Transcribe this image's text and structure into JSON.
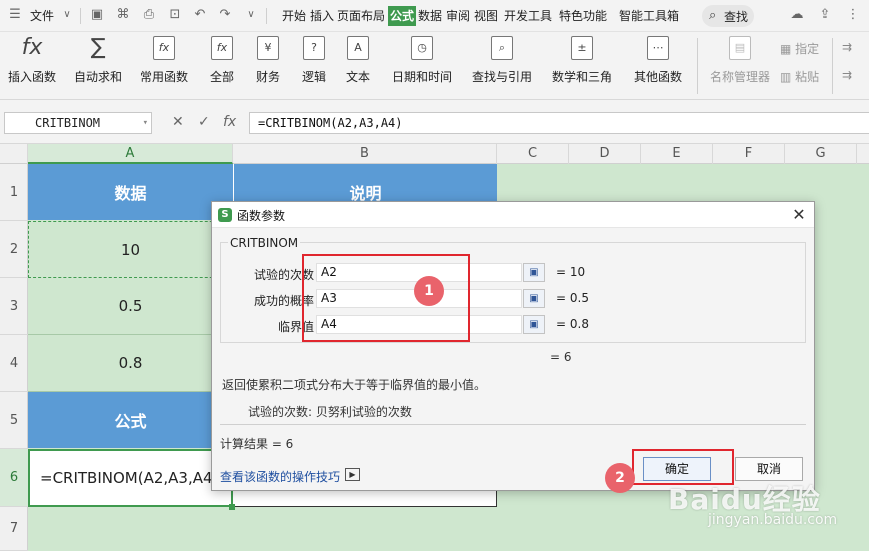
{
  "menubar": {
    "file_label": "文件",
    "menus": [
      "开始",
      "插入",
      "页面布局",
      "公式",
      "数据",
      "审阅",
      "视图",
      "开发工具",
      "特色功能",
      "智能工具箱"
    ],
    "active_menu": "公式",
    "search_label": "查找"
  },
  "ribbon": {
    "buttons": [
      {
        "label": "插入函数",
        "icon": "fx-icon"
      },
      {
        "label": "自动求和",
        "icon": "sigma-icon"
      },
      {
        "label": "常用函数",
        "icon": "star-fx-icon"
      },
      {
        "label": "全部",
        "icon": "fx-box-icon"
      },
      {
        "label": "财务",
        "icon": "yen-icon"
      },
      {
        "label": "逻辑",
        "icon": "question-icon"
      },
      {
        "label": "文本",
        "icon": "text-a-icon"
      },
      {
        "label": "日期和时间",
        "icon": "clock-icon"
      },
      {
        "label": "查找与引用",
        "icon": "lookup-icon"
      },
      {
        "label": "数学和三角",
        "icon": "math-icon"
      },
      {
        "label": "其他函数",
        "icon": "more-functions-icon"
      }
    ],
    "name_manager_label": "名称管理器",
    "define_label": "指定",
    "paste_label": "粘贴"
  },
  "formula_bar": {
    "name_box": "CRITBINOM",
    "formula": "=CRITBINOM(A2,A3,A4)"
  },
  "sheet": {
    "columns": [
      "A",
      "B",
      "C",
      "D",
      "E",
      "F",
      "G"
    ],
    "rows": [
      "1",
      "2",
      "3",
      "4",
      "5",
      "6",
      "7"
    ],
    "header_data": "数据",
    "header_desc": "说明",
    "values": [
      "10",
      "0.5",
      "0.8"
    ],
    "formula_header": "公式",
    "formula_cell": "=CRITBINOM(A2,A3,A4"
  },
  "dialog": {
    "title": "函数参数",
    "function_name": "CRITBINOM",
    "args": [
      {
        "label": "试验的次数",
        "value": "A2",
        "result": "= 10"
      },
      {
        "label": "成功的概率",
        "value": "A3",
        "result": "= 0.5"
      },
      {
        "label": "临界值",
        "value": "A4",
        "result": "= 0.8"
      }
    ],
    "total_result": "= 6",
    "description": "返回使累积二项式分布大于等于临界值的最小值。",
    "arg_description": "试验的次数:  贝努利试验的次数",
    "calc_result": "计算结果 =  6",
    "help_link": "查看该函数的操作技巧",
    "ok_label": "确定",
    "cancel_label": "取消"
  },
  "annotations": {
    "badge1": "1",
    "badge2": "2"
  },
  "watermark": {
    "line1": "Baidu经验",
    "line2": "jingyan.baidu.com"
  },
  "colors": {
    "accent_green": "#3f9a4f",
    "header_blue": "#5b9bd5",
    "sheet_green": "#cfe7cf",
    "annotation_red": "#e0262e"
  }
}
